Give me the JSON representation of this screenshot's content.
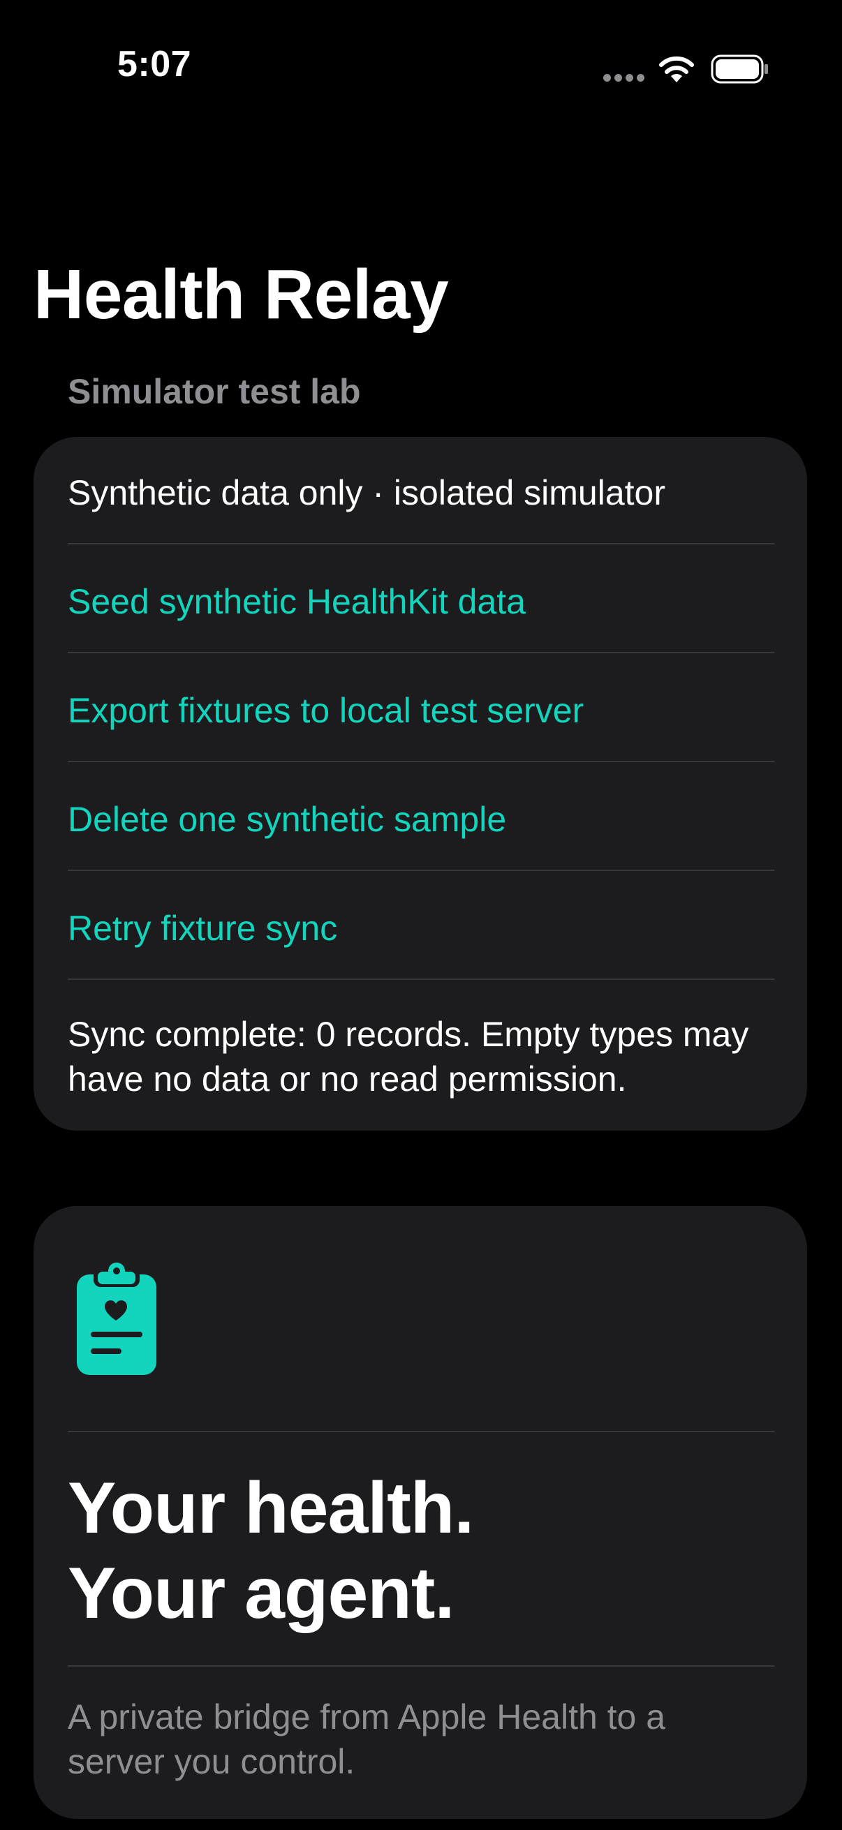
{
  "status_bar": {
    "time": "5:07"
  },
  "nav": {
    "title": "Health Relay"
  },
  "lab_section": {
    "header": "Simulator test lab",
    "info_text": "Synthetic data only · isolated simulator",
    "actions": [
      {
        "label": "Seed synthetic HealthKit data"
      },
      {
        "label": "Export fixtures to local test server"
      },
      {
        "label": "Delete one synthetic sample"
      },
      {
        "label": "Retry fixture sync"
      }
    ],
    "status_line_1": "Sync complete: 0 records. Empty types may",
    "status_line_2": "have no data or no read permission."
  },
  "intro_card": {
    "icon": "clipboard-heart-icon",
    "headline_line_1": "Your health.",
    "headline_line_2": "Your agent.",
    "subtitle_line_1": "A private bridge from Apple Health to a",
    "subtitle_line_2": "server you control."
  },
  "colors": {
    "accent": "#13d5bd",
    "background": "#000000",
    "card": "#1c1c1e",
    "secondary_text": "#8e8e93",
    "separator": "#38383a"
  }
}
